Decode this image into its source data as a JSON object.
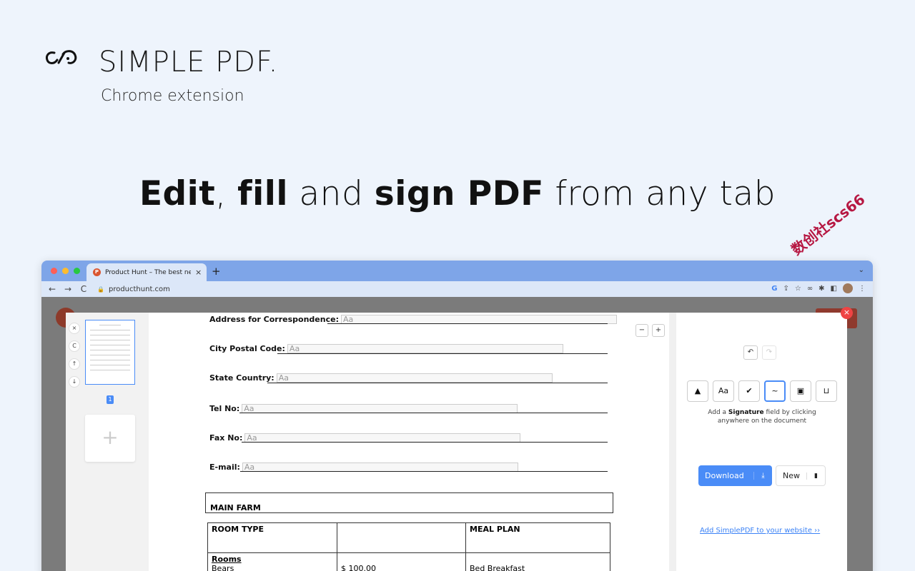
{
  "brand": {
    "name": "SIMPLE PDF.",
    "subtitle": "Chrome extension",
    "logo_icon": "infinity-loop-icon"
  },
  "headline": {
    "part1": "Edit",
    "sep1": ", ",
    "part2": "fill",
    "part3": " and ",
    "part4": "sign PDF",
    "part5": " from any tab"
  },
  "watermark": "数创社scs66",
  "browser": {
    "tab_title": "Product Hunt – The best new p",
    "tab_favicon": "P",
    "tab_close": "×",
    "new_tab": "+",
    "url": "producthunt.com",
    "nav": {
      "back": "←",
      "forward": "→",
      "reload": "C"
    }
  },
  "editor": {
    "page_number": "1",
    "add_page": "+",
    "thumbnail_tools": [
      "×",
      "C",
      "↑",
      "↓"
    ],
    "zoom_out": "−",
    "zoom_in": "+",
    "fields": [
      {
        "label": "Address for Correspondence:",
        "placeholder": "Aa"
      },
      {
        "label": "City Postal Code:",
        "placeholder": "Aa"
      },
      {
        "label": "State Country:",
        "placeholder": "Aa"
      },
      {
        "label": "Tel No:",
        "placeholder": "Aa"
      },
      {
        "label": "Fax No:",
        "placeholder": "Aa"
      },
      {
        "label": "E-mail:",
        "placeholder": "Aa"
      }
    ],
    "main_farm": "MAIN FARM",
    "table": {
      "headers": [
        "ROOM TYPE",
        "",
        "MEAL PLAN"
      ],
      "row_heading": "Rooms",
      "row": [
        "Bears",
        "$ 100.00",
        "Bed Breakfast"
      ]
    }
  },
  "panel": {
    "close": "×",
    "undo": "↶",
    "redo": "↷",
    "tools": [
      "▲",
      "Aa",
      "✔",
      "~",
      "▣",
      "⊔"
    ],
    "hint_prefix": "Add a ",
    "hint_bold": "Signature",
    "hint_suffix": " field by clicking anywhere on the document",
    "download": "Download",
    "download_icon": "⤓",
    "new": "New",
    "new_icon": "▮",
    "add_link": "Add SimplePDF to your website ››"
  },
  "colors": {
    "page_bg": "#eef4fc",
    "accent_blue": "#4a8cf7",
    "tabbar": "#7ea5e8",
    "close_red": "#ef4444"
  }
}
